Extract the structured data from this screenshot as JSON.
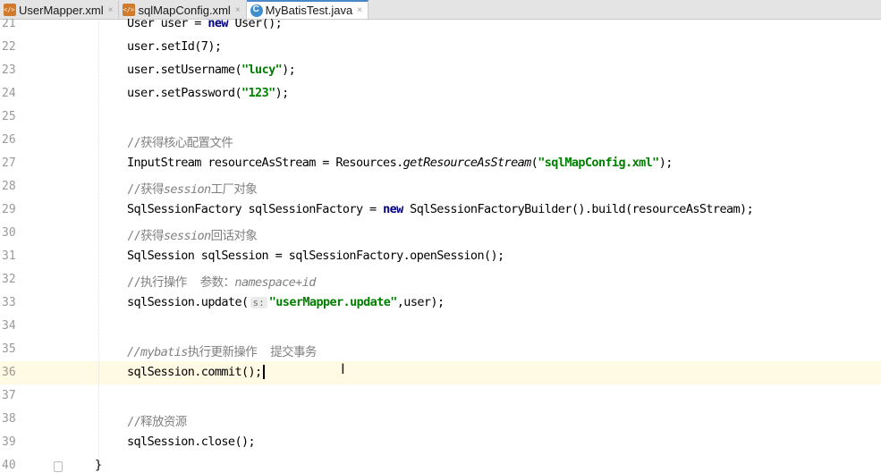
{
  "tabs": [
    {
      "label": "UserMapper.xml",
      "icon": "xml-file-icon",
      "active": false
    },
    {
      "label": "sqlMapConfig.xml",
      "icon": "xml-file-icon",
      "active": false
    },
    {
      "label": "MyBatisTest.java",
      "icon": "java-class-icon",
      "active": true
    }
  ],
  "close_glyph": "×",
  "lines": [
    {
      "n": "21",
      "parts": [
        [
          "t",
          "User user = "
        ],
        [
          "kw",
          "new"
        ],
        [
          "t",
          " User();"
        ]
      ]
    },
    {
      "n": "22",
      "parts": [
        [
          "t",
          "user.setId(7);"
        ]
      ]
    },
    {
      "n": "23",
      "parts": [
        [
          "t",
          "user.setUsername("
        ],
        [
          "str",
          "\"lucy\""
        ],
        [
          "t",
          ");"
        ]
      ]
    },
    {
      "n": "24",
      "parts": [
        [
          "t",
          "user.setPassword("
        ],
        [
          "str",
          "\"123\""
        ],
        [
          "t",
          ");"
        ]
      ]
    },
    {
      "n": "25",
      "parts": []
    },
    {
      "n": "26",
      "parts": [
        [
          "cmt",
          "//获得核心配置文件"
        ]
      ]
    },
    {
      "n": "27",
      "parts": [
        [
          "t",
          "InputStream resourceAsStream = Resources."
        ],
        [
          "it",
          "getResourceAsStream"
        ],
        [
          "t",
          "("
        ],
        [
          "str",
          "\"sqlMapConfig.xml\""
        ],
        [
          "t",
          ");"
        ]
      ]
    },
    {
      "n": "28",
      "parts": [
        [
          "cmt",
          "//获得"
        ],
        [
          "cmti",
          "session"
        ],
        [
          "cmt",
          "工厂对象"
        ]
      ]
    },
    {
      "n": "29",
      "parts": [
        [
          "t",
          "SqlSessionFactory sqlSessionFactory = "
        ],
        [
          "kw",
          "new"
        ],
        [
          "t",
          " SqlSessionFactoryBuilder().build(resourceAsStream);"
        ]
      ]
    },
    {
      "n": "30",
      "parts": [
        [
          "cmt",
          "//获得"
        ],
        [
          "cmti",
          "session"
        ],
        [
          "cmt",
          "回话对象"
        ]
      ]
    },
    {
      "n": "31",
      "parts": [
        [
          "t",
          "SqlSession sqlSession = sqlSessionFactory.openSession();"
        ]
      ]
    },
    {
      "n": "32",
      "parts": [
        [
          "cmt",
          "//执行操作  参数："
        ],
        [
          "cmti",
          "namespace+id"
        ]
      ]
    },
    {
      "n": "33",
      "parts": [
        [
          "t",
          "sqlSession.update("
        ],
        [
          "hint",
          "s:"
        ],
        [
          "str",
          "\"userMapper.update\""
        ],
        [
          "t",
          ",user);"
        ]
      ]
    },
    {
      "n": "34",
      "parts": []
    },
    {
      "n": "35",
      "parts": [
        [
          "cmti",
          "//mybatis"
        ],
        [
          "cmt",
          "执行更新操作  提交事务"
        ]
      ]
    },
    {
      "n": "36",
      "parts": [
        [
          "t",
          "sqlSession.commit();"
        ],
        [
          "caret",
          ""
        ]
      ],
      "current": true
    },
    {
      "n": "37",
      "parts": []
    },
    {
      "n": "38",
      "parts": [
        [
          "cmt",
          "//释放资源"
        ]
      ]
    },
    {
      "n": "39",
      "parts": [
        [
          "t",
          "sqlSession.close();"
        ]
      ]
    },
    {
      "n": "40",
      "parts": []
    }
  ],
  "closing_brace": "}",
  "cursor_glyph": "I"
}
